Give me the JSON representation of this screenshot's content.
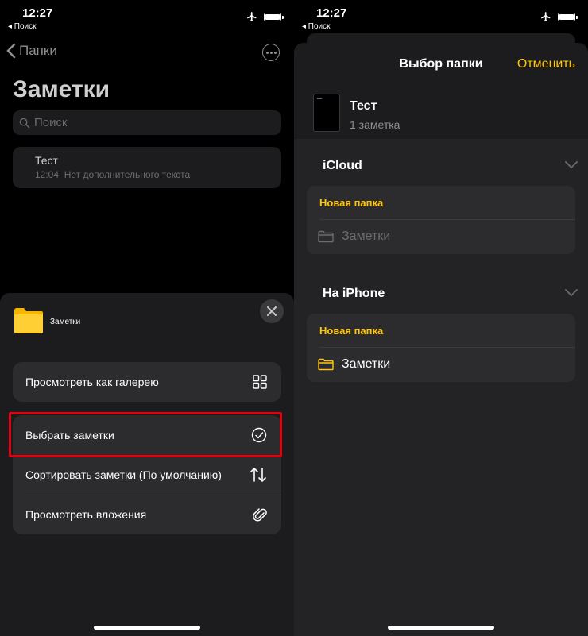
{
  "status": {
    "time": "12:27",
    "back_label": "◂ Поиск"
  },
  "left": {
    "nav_back_label": "Папки",
    "title": "Заметки",
    "search_placeholder": "Поиск",
    "note": {
      "title": "Тест",
      "time": "12:04",
      "preview": "Нет дополнительного текста"
    },
    "sheet": {
      "folder_name": "Заметки",
      "group1": [
        {
          "label": "Просмотреть как галерею",
          "icon": "grid-icon"
        }
      ],
      "group2": [
        {
          "label": "Выбрать заметки",
          "icon": "checkmark-circle-icon"
        },
        {
          "label": "Сортировать заметки (По умолчанию)",
          "icon": "sort-arrows-icon"
        },
        {
          "label": "Просмотреть вложения",
          "icon": "paperclip-icon"
        }
      ],
      "highlighted_item": "Выбрать заметки"
    }
  },
  "right": {
    "sheet_title": "Выбор папки",
    "cancel_label": "Отменить",
    "note": {
      "title": "Тест",
      "count": "1 заметка"
    },
    "sections": [
      {
        "title": "iCloud",
        "new_folder": "Новая папка",
        "folder": "Заметки",
        "folder_enabled": false
      },
      {
        "title": "На iPhone",
        "new_folder": "Новая папка",
        "folder": "Заметки",
        "folder_enabled": true
      }
    ]
  },
  "colors": {
    "accent": "#ffc60a",
    "highlight": "#e3000f",
    "sheet": "#1c1c1e",
    "cell": "#2c2c2e"
  }
}
